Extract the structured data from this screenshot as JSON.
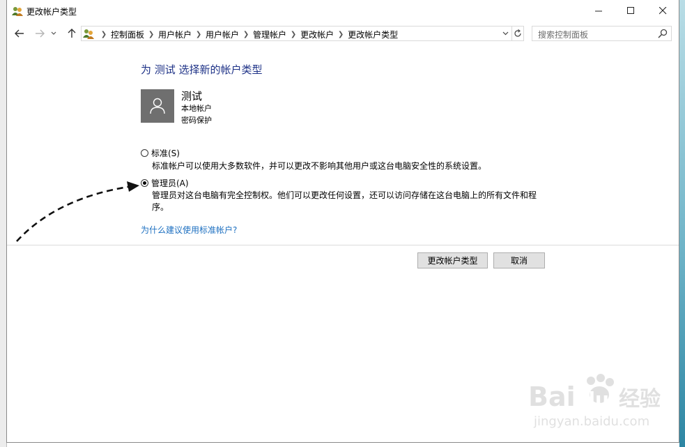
{
  "window": {
    "title": "更改帐户类型"
  },
  "navigation": {
    "breadcrumbs": [
      "控制面板",
      "用户帐户",
      "用户帐户",
      "管理帐户",
      "更改帐户",
      "更改帐户类型"
    ],
    "search_placeholder": "搜索控制面板"
  },
  "content": {
    "heading": "为 测试 选择新的帐户类型",
    "account": {
      "name": "测试",
      "type": "本地帐户",
      "protection": "密码保护"
    },
    "options": [
      {
        "label": "标准(S)",
        "description": "标准帐户可以使用大多数软件，并可以更改不影响其他用户或这台电脑安全性的系统设置。",
        "selected": false
      },
      {
        "label": "管理员(A)",
        "description": "管理员对这台电脑有完全控制权。他们可以更改任何设置，还可以访问存储在这台电脑上的所有文件和程序。",
        "selected": true
      }
    ],
    "why_link": "为什么建议使用标准帐户?"
  },
  "buttons": {
    "change": "更改帐户类型",
    "cancel": "取消"
  },
  "watermark": {
    "brand": "Bai",
    "brand_suffix": "du",
    "product": "经验",
    "url": "jingyan.baidu.com"
  },
  "colors": {
    "heading": "#1e3287",
    "link": "#1c6fc0",
    "avatar_bg": "#6f6f6f",
    "button_bg": "#e1e1e1"
  },
  "icons": {
    "title": "users-icon",
    "back": "arrow-left-icon",
    "forward": "arrow-right-icon",
    "recent": "chevron-down-icon",
    "up": "arrow-up-icon",
    "refresh": "refresh-icon",
    "search": "search-icon",
    "avatar": "user-silhouette-icon"
  }
}
